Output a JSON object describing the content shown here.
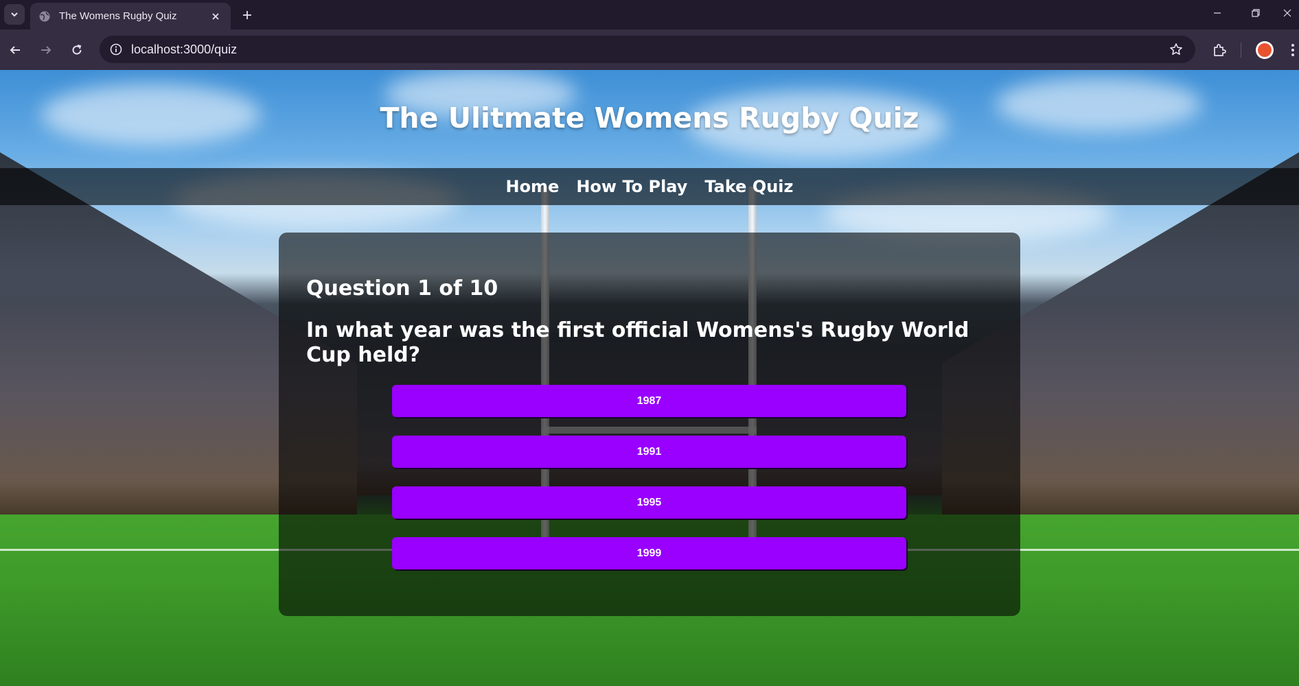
{
  "browser": {
    "tab_title": "The Womens Rugby Quiz",
    "url": "localhost:3000/quiz"
  },
  "page": {
    "title": "The Ulitmate Womens Rugby Quiz",
    "nav": [
      {
        "label": "Home"
      },
      {
        "label": "How To Play"
      },
      {
        "label": "Take Quiz"
      }
    ]
  },
  "quiz": {
    "counter": "Question 1 of 10",
    "question": "In what year was the first official Womens's Rugby World Cup held?",
    "answers": [
      {
        "label": "1987"
      },
      {
        "label": "1991"
      },
      {
        "label": "1995"
      },
      {
        "label": "1999"
      }
    ],
    "answer_color": "#9900ff"
  },
  "icons": {
    "tab_search": "chevron-down-icon",
    "favicon": "globe-icon",
    "tab_close": "close-icon",
    "new_tab": "plus-icon",
    "back": "arrow-left-icon",
    "forward": "arrow-right-icon",
    "reload": "reload-icon",
    "site_info": "info-icon",
    "bookmark": "star-icon",
    "extensions": "puzzle-icon",
    "menu": "more-vertical-icon"
  }
}
